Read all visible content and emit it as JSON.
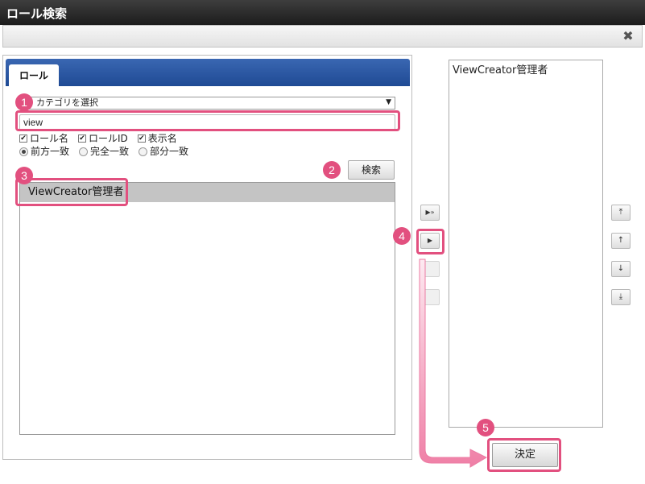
{
  "window": {
    "title": "ロール検索"
  },
  "left_panel": {
    "tab_label": "ロール",
    "category_select": {
      "selected": "カテゴリを選択"
    },
    "search_input": {
      "value": "view"
    },
    "checkboxes": [
      {
        "label": "ロール名",
        "checked": true
      },
      {
        "label": "ロールID",
        "checked": true
      },
      {
        "label": "表示名",
        "checked": true
      }
    ],
    "radios": [
      {
        "label": "前方一致",
        "selected": true
      },
      {
        "label": "完全一致",
        "selected": false
      },
      {
        "label": "部分一致",
        "selected": false
      }
    ],
    "search_button": "検索",
    "results": [
      "ViewCreator管理者"
    ]
  },
  "right_panel": {
    "items": [
      "ViewCreator管理者"
    ]
  },
  "decide_button": "決定",
  "annotations": [
    "1",
    "2",
    "3",
    "4",
    "5"
  ],
  "colors": {
    "accent": "#e2507f",
    "tab_bar": "#2a57a4",
    "titlebar": "#2b2b2b"
  }
}
